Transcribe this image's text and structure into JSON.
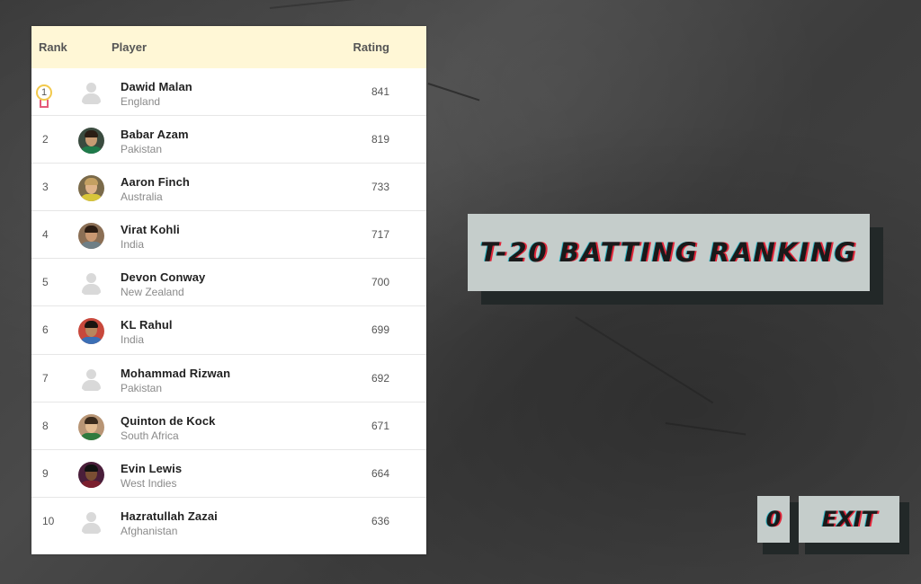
{
  "table": {
    "headers": {
      "rank": "Rank",
      "player": "Player",
      "rating": "Rating"
    },
    "rows": [
      {
        "rank": "1",
        "name": "Dawid Malan",
        "country": "England",
        "rating": "841",
        "avatar": "placeholder-avatar-icon"
      },
      {
        "rank": "2",
        "name": "Babar Azam",
        "country": "Pakistan",
        "rating": "819",
        "avatar": "player-photo"
      },
      {
        "rank": "3",
        "name": "Aaron Finch",
        "country": "Australia",
        "rating": "733",
        "avatar": "player-photo"
      },
      {
        "rank": "4",
        "name": "Virat Kohli",
        "country": "India",
        "rating": "717",
        "avatar": "player-photo"
      },
      {
        "rank": "5",
        "name": "Devon Conway",
        "country": "New Zealand",
        "rating": "700",
        "avatar": "placeholder-avatar-icon"
      },
      {
        "rank": "6",
        "name": "KL Rahul",
        "country": "India",
        "rating": "699",
        "avatar": "player-photo"
      },
      {
        "rank": "7",
        "name": "Mohammad Rizwan",
        "country": "Pakistan",
        "rating": "692",
        "avatar": "placeholder-avatar-icon"
      },
      {
        "rank": "8",
        "name": "Quinton de Kock",
        "country": "South Africa",
        "rating": "671",
        "avatar": "player-photo"
      },
      {
        "rank": "9",
        "name": "Evin Lewis",
        "country": "West Indies",
        "rating": "664",
        "avatar": "player-photo"
      },
      {
        "rank": "10",
        "name": "Hazratullah Zazai",
        "country": "Afghanistan",
        "rating": "636",
        "avatar": "placeholder-avatar-icon"
      }
    ]
  },
  "banner": {
    "title": "T-20 BATTING RANKING"
  },
  "controls": {
    "small_label": "0",
    "exit_label": "EXIT"
  },
  "colors": {
    "header_bg": "#fff7d6",
    "button_bg": "#c5cdcb",
    "button_shadow": "#222828",
    "text_glitch_red": "#e3263a",
    "text_glitch_cyan": "#2bb5c4",
    "medal_gold": "#f2c94c",
    "medal_ribbon": "#e55b7a"
  }
}
